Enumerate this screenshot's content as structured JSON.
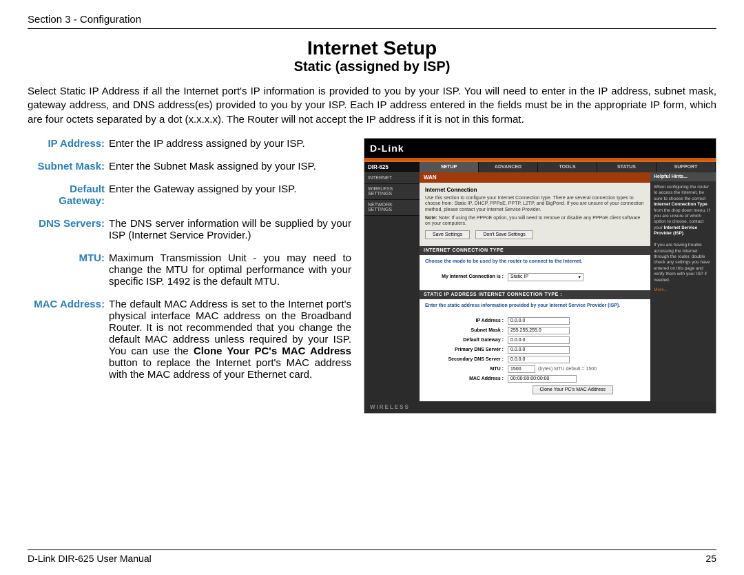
{
  "header": {
    "section": "Section 3 - Configuration"
  },
  "title": "Internet Setup",
  "subtitle": "Static (assigned by ISP)",
  "intro": "Select Static IP Address if all the Internet port's IP information is provided to you by your ISP. You will need to enter in the IP address, subnet mask, gateway address, and DNS address(es) provided to you by your ISP. Each IP address entered in the fields must be in the appropriate IP form, which are four octets separated by a dot (x.x.x.x). The Router will not accept the IP address if it is not in this format.",
  "defs": {
    "ip_address": {
      "label": "IP Address:",
      "text": "Enter the IP address assigned by your ISP."
    },
    "subnet_mask": {
      "label": "Subnet Mask:",
      "text": "Enter the Subnet Mask assigned by your ISP."
    },
    "default_gateway": {
      "label": "Default Gateway:",
      "text": "Enter the Gateway assigned by your ISP."
    },
    "dns_servers": {
      "label": "DNS Servers:",
      "text": "The DNS server information will be supplied by your ISP (Internet Service Provider.)"
    },
    "mtu": {
      "label": "MTU:",
      "text": "Maximum Transmission Unit - you may need to change the MTU for optimal performance with your specific ISP. 1492 is the default MTU."
    },
    "mac_address": {
      "label": "MAC Address:",
      "pre": "The default MAC Address is set to the Internet port's physical interface MAC address on the Broadband Router. It is not recommended that you change the default MAC address unless required by your ISP. You can use the ",
      "bold": "Clone Your PC's MAC Address",
      "post": " button to replace the Internet port's MAC address with the MAC address of your Ethernet card."
    }
  },
  "screenshot": {
    "logo": "D-Link",
    "model": "DIR-625",
    "nav": {
      "internet": "INTERNET",
      "wireless": "WIRELESS SETTINGS",
      "network": "NETWORK SETTINGS"
    },
    "tabs": {
      "setup": "SETUP",
      "advanced": "ADVANCED",
      "tools": "TOOLS",
      "status": "STATUS",
      "support": "SUPPORT"
    },
    "wan": {
      "title": "WAN",
      "section_hdr": "Internet Connection",
      "section_txt": "Use this section to configure your Internet Connection type. There are several connection types to choose from: Static IP, DHCP, PPPoE, PPTP, L2TP, and BigPond. If you are unsure of your connection method, please contact your Internet Service Provider.",
      "note": "Note: If using the PPPoE option, you will need to remove or disable any PPPoE client software on your computers.",
      "save": "Save Settings",
      "dont_save": "Don't Save Settings"
    },
    "conn_type": {
      "title": "INTERNET CONNECTION TYPE",
      "note": "Choose the mode to be used by the router to connect to the Internet.",
      "label": "My Internet Connection is :",
      "value": "Static IP"
    },
    "static": {
      "title": "STATIC IP ADDRESS INTERNET CONNECTION TYPE :",
      "note": "Enter the static address information provided by your Internet Service Provider (ISP).",
      "fields": {
        "ip": {
          "label": "IP Address :",
          "value": "0.0.0.0"
        },
        "subnet": {
          "label": "Subnet Mask :",
          "value": "255.255.255.0"
        },
        "gateway": {
          "label": "Default Gateway :",
          "value": "0.0.0.0"
        },
        "dns1": {
          "label": "Primary DNS Server :",
          "value": "0.0.0.0"
        },
        "dns2": {
          "label": "Secondary DNS Server :",
          "value": "0.0.0.0"
        },
        "mtu": {
          "label": "MTU :",
          "value": "1500",
          "after": "(bytes)   MTU default = 1500"
        },
        "mac": {
          "label": "MAC Address :",
          "value": "00:00:00:00:00:00"
        }
      },
      "clone": "Clone Your PC's MAC Address"
    },
    "hints": {
      "title": "Helpful Hints...",
      "body1": "When configuring the router to access the Internet, be sure to choose the correct ",
      "b1": "Internet Connection Type",
      "body2": " from the drop down menu. If you are unsure of which option to choose, contact your ",
      "b2": "Internet Service Provider (ISP)",
      "body3": ".",
      "body4": "If you are having trouble accessing the Internet through the router, double check any settings you have entered on this page and verify them with your ISP if needed.",
      "more": "More..."
    },
    "footer": "WIRELESS"
  },
  "footer": {
    "manual": "D-Link DIR-625 User Manual",
    "page": "25"
  }
}
